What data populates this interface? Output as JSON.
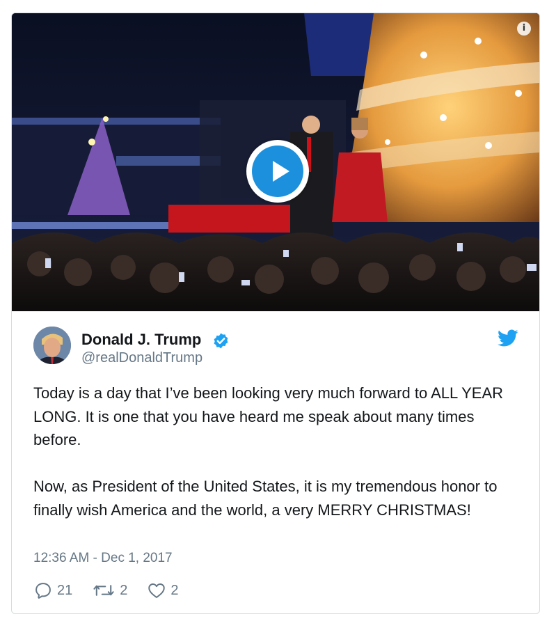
{
  "tweet": {
    "author": {
      "display_name": "Donald J. Trump",
      "handle": "@realDonaldTrump",
      "verified": true
    },
    "paragraphs": [
      "Today is a day that I’ve been looking very much forward to ALL YEAR LONG. It is one that you have heard me speak about many times before.",
      "Now, as President of the United States, it is my tremendous honor to finally wish America and the world, a very MERRY CHRISTMAS!"
    ],
    "timestamp": "12:36 AM - Dec 1, 2017",
    "actions": {
      "replies": "21",
      "retweets": "2",
      "likes": "2"
    }
  },
  "media": {
    "type": "video",
    "info_glyph": "i"
  },
  "colors": {
    "accent": "#1da1f2",
    "play": "#1c90dc",
    "text": "#14171a",
    "muted": "#657786",
    "border": "#d6dbe0"
  },
  "icons": {
    "play": "play-icon",
    "info": "info-icon",
    "verified": "verified-badge-icon",
    "brand": "twitter-bird-icon",
    "reply": "reply-icon",
    "retweet": "retweet-icon",
    "like": "heart-icon"
  }
}
